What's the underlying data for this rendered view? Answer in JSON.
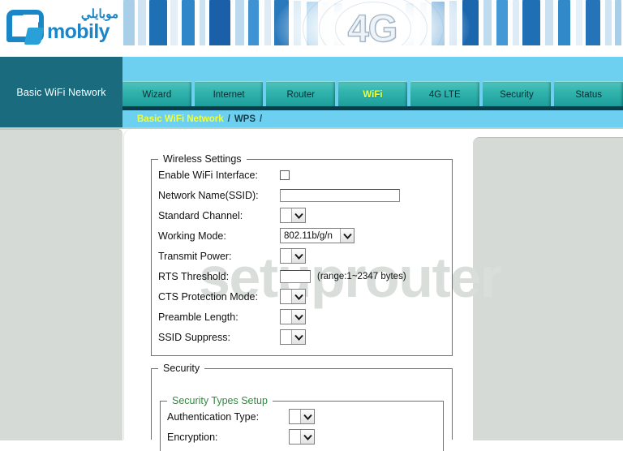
{
  "brand": {
    "logo_arabic": "موبايلي",
    "logo_latin": "mobily",
    "banner_text": "4G"
  },
  "sidebox": {
    "label": "Basic WiFi Network"
  },
  "nav": {
    "tabs": [
      {
        "label": "Wizard",
        "active": false
      },
      {
        "label": "Internet",
        "active": false
      },
      {
        "label": "Router",
        "active": false
      },
      {
        "label": "WiFi",
        "active": true
      },
      {
        "label": "4G LTE",
        "active": false
      },
      {
        "label": "Security",
        "active": false
      },
      {
        "label": "Status",
        "active": false
      }
    ],
    "breadcrumb": {
      "item1": "Basic WiFi Network",
      "sep1": "/",
      "item2": "WPS",
      "sep2": "/"
    }
  },
  "watermark": {
    "text": "setuprouter"
  },
  "wireless": {
    "legend": "Wireless Settings",
    "enable_wifi": {
      "label": "Enable WiFi Interface:",
      "checked": false
    },
    "ssid": {
      "label": "Network Name(SSID):",
      "value": "",
      "placeholder": ""
    },
    "standard_channel": {
      "label": "Standard Channel:",
      "value": ""
    },
    "working_mode": {
      "label": "Working Mode:",
      "value": "802.11b/g/n"
    },
    "transmit_power": {
      "label": "Transmit Power:",
      "value": ""
    },
    "rts_threshold": {
      "label": "RTS Threshold:",
      "value": "",
      "hint": "(range:1~2347 bytes)"
    },
    "cts_protection": {
      "label": "CTS Protection Mode:",
      "value": ""
    },
    "preamble_length": {
      "label": "Preamble Length:",
      "value": ""
    },
    "ssid_suppress": {
      "label": "SSID Suppress:",
      "value": ""
    }
  },
  "security": {
    "legend": "Security",
    "types_setup": {
      "legend": "Security Types Setup",
      "authentication_type": {
        "label": "Authentication Type:",
        "value": ""
      },
      "encryption": {
        "label": "Encryption:",
        "value": ""
      }
    }
  },
  "colors": {
    "teal_dark": "#196b7d",
    "sky": "#6ed0f0",
    "tab_teal": "#31b3ad",
    "active_yellow": "#f2ff33",
    "brand_blue": "#1a86c8",
    "legend_green": "#2e8b3e",
    "panel_grey": "#d5dad7"
  }
}
